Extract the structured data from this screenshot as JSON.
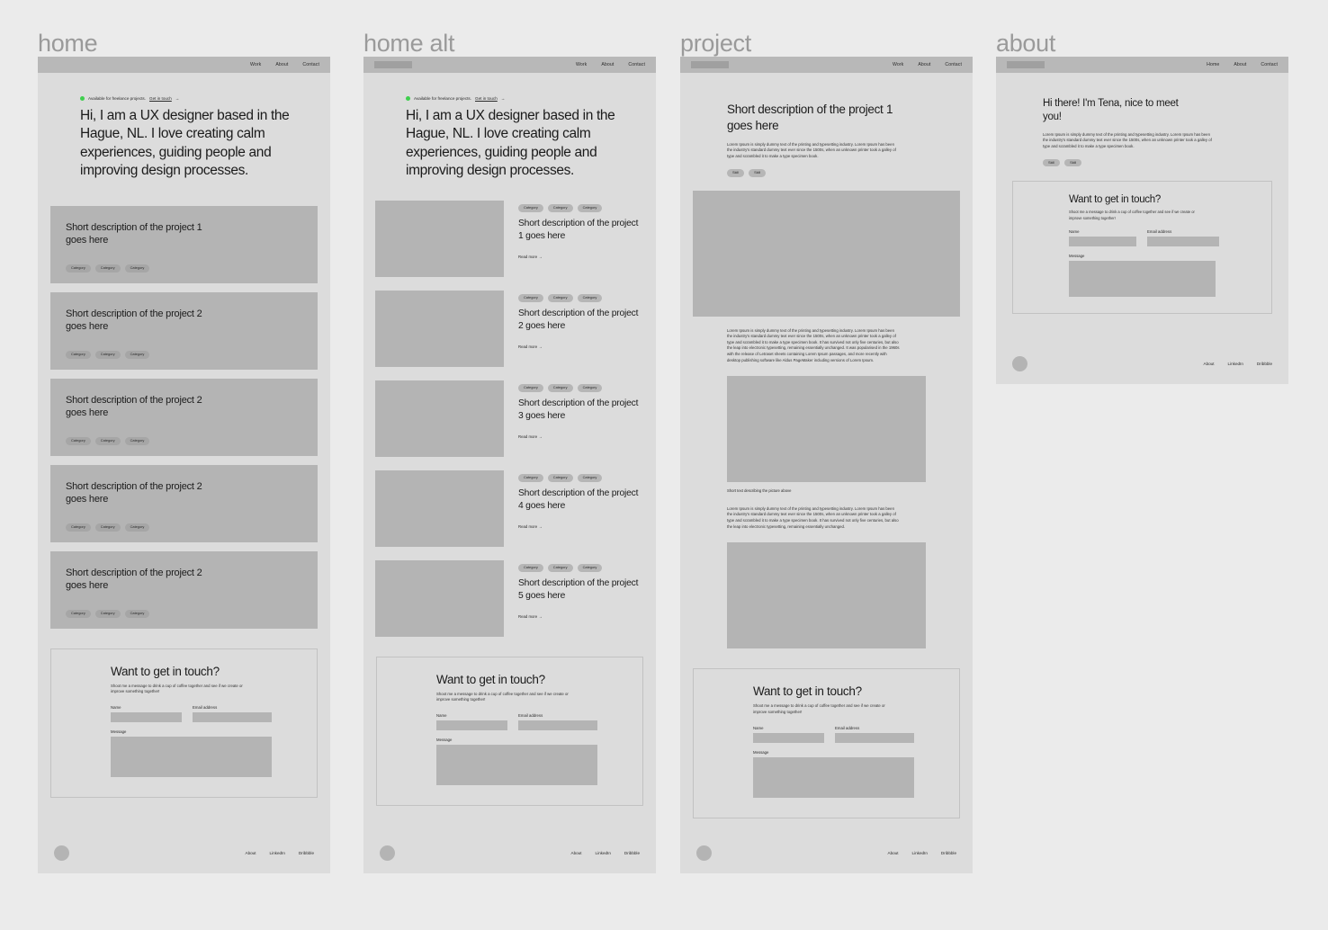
{
  "columns": [
    {
      "label": "home"
    },
    {
      "label": "home alt"
    },
    {
      "label": "project"
    },
    {
      "label": "about"
    }
  ],
  "nav": {
    "work": "Work",
    "about": "About",
    "contact": "Contact",
    "home": "Home"
  },
  "hero": {
    "availability": "Available for freelance projects.",
    "cta": "Get in touch",
    "arrow": "→",
    "title": "Hi, I am a UX designer based in the Hague, NL. I love creating calm experiences, guiding people and improving design processes."
  },
  "home_cards": [
    {
      "title": "Short description of the project 1 goes here",
      "tags": [
        "Category",
        "Category",
        "Category"
      ]
    },
    {
      "title": "Short description of the project 2 goes here",
      "tags": [
        "Category",
        "Category",
        "Category"
      ]
    },
    {
      "title": "Short description of the project 2 goes here",
      "tags": [
        "Category",
        "Category",
        "Category"
      ]
    },
    {
      "title": "Short description of the project 2 goes here",
      "tags": [
        "Category",
        "Category",
        "Category"
      ]
    },
    {
      "title": "Short description of the project 2 goes here",
      "tags": [
        "Category",
        "Category",
        "Category"
      ]
    }
  ],
  "alt_items": [
    {
      "title": "Short description of the project 1 goes here",
      "tags": [
        "Category",
        "Category",
        "Category"
      ],
      "readmore": "Read more →"
    },
    {
      "title": "Short description of the project 2 goes here",
      "tags": [
        "Category",
        "Category",
        "Category"
      ],
      "readmore": "Read more →"
    },
    {
      "title": "Short description of the project 3 goes here",
      "tags": [
        "Category",
        "Category",
        "Category"
      ],
      "readmore": "Read more →"
    },
    {
      "title": "Short description of the project 4 goes here",
      "tags": [
        "Category",
        "Category",
        "Category"
      ],
      "readmore": "Read more →"
    },
    {
      "title": "Short description of the project 5 goes here",
      "tags": [
        "Category",
        "Category",
        "Category"
      ],
      "readmore": "Read more →"
    }
  ],
  "project": {
    "title": "Short description of the project 1 goes here",
    "intro": "Lorem Ipsum is simply dummy text of the printing and typesetting industry. Lorem Ipsum has been the industry's standard dummy text ever since the 1500s, when an unknown printer took a galley of type and scrambled it to make a type specimen book.",
    "skills": [
      "Skill",
      "Skill"
    ],
    "paragraph_long": "Lorem Ipsum is simply dummy text of the printing and typesetting industry. Lorem Ipsum has been the industry's standard dummy text ever since the 1500s, when an unknown printer took a galley of type and scrambled it to make a type specimen book. It has survived not only five centuries, but also the leap into electronic typesetting, remaining essentially unchanged. It was popularised in the 1960s with the release of Letraset sheets containing Lorem Ipsum passages, and more recently with desktop publishing software like Aldus PageMaker including versions of Lorem Ipsum.",
    "caption": "Short text describing the picture above",
    "paragraph_short": "Lorem Ipsum is simply dummy text of the printing and typesetting industry. Lorem Ipsum has been the industry's standard dummy text ever since the 1500s, when an unknown printer took a galley of type and scrambled it to make a type specimen book. It has survived not only five centuries, but also the leap into electronic typesetting, remaining essentially unchanged."
  },
  "about": {
    "title": "Hi there! I'm Tena, nice to meet you!",
    "intro": "Lorem Ipsum is simply dummy text of the printing and typesetting industry. Lorem Ipsum has been the industry's standard dummy text ever since the 1500s, when an unknown printer took a galley of type and scrambled it to make a type specimen book.",
    "skills": [
      "Skill",
      "Skill"
    ]
  },
  "contact": {
    "title": "Want to get in touch?",
    "subtitle": "Shoot me a message to drink a cup of coffee together and see if we create or improve something together!",
    "name_label": "Name",
    "email_label": "Email address",
    "message_label": "Message"
  },
  "footer": {
    "links": [
      "About",
      "LinkedIn",
      "Dribbble"
    ]
  },
  "colors": {
    "canvas": "#ebebeb",
    "page": "#dcdcdc",
    "navbar": "#b8b8b8",
    "block": "#b4b4b4",
    "accent_green": "#3fcf4e",
    "label": "#9a9a9a"
  }
}
